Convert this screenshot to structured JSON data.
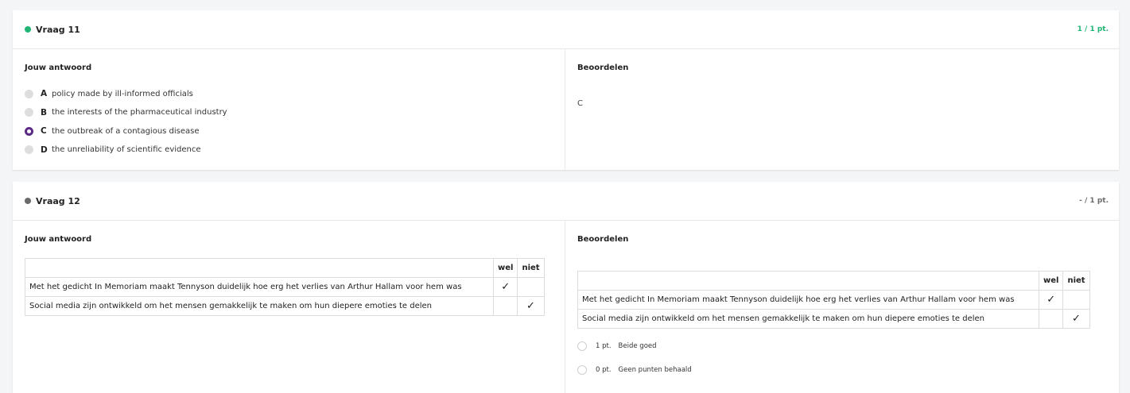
{
  "colors": {
    "correct": "#21b573",
    "pending": "#6b6b6b",
    "accent": "#5b2a86"
  },
  "q11": {
    "title": "Vraag 11",
    "score": "1 / 1 pt.",
    "your_answer_label": "Jouw antwoord",
    "grade_label": "Beoordelen",
    "options": [
      {
        "letter": "A",
        "text": "policy made by ill-informed officials",
        "selected": false
      },
      {
        "letter": "B",
        "text": "the interests of the pharmaceutical industry",
        "selected": false
      },
      {
        "letter": "C",
        "text": "the outbreak of a contagious disease",
        "selected": true
      },
      {
        "letter": "D",
        "text": "the unreliability of scientific evidence",
        "selected": false
      }
    ],
    "correct_answer": "C"
  },
  "q12": {
    "title": "Vraag 12",
    "score": "- / 1 pt.",
    "your_answer_label": "Jouw antwoord",
    "grade_label": "Beoordelen",
    "table": {
      "headers": [
        "wel",
        "niet"
      ],
      "rows": [
        {
          "statement": "Met het gedicht In Memoriam maakt Tennyson duidelijk hoe erg het verlies van Arthur Hallam voor hem was",
          "wel": "✓",
          "niet": ""
        },
        {
          "statement": "Social media zijn ontwikkeld om het mensen gemakkelijk te maken om hun diepere emoties te delen",
          "wel": "",
          "niet": "✓"
        }
      ]
    },
    "grade_table": {
      "headers": [
        "wel",
        "niet"
      ],
      "rows": [
        {
          "statement": "Met het gedicht In Memoriam maakt Tennyson duidelijk hoe erg het verlies van Arthur Hallam voor hem was",
          "wel": "✓",
          "niet": ""
        },
        {
          "statement": "Social media zijn ontwikkeld om het mensen gemakkelijk te maken om hun diepere emoties te delen",
          "wel": "",
          "niet": "✓"
        }
      ]
    },
    "score_options": [
      {
        "points": "1 pt.",
        "label": "Beide goed"
      },
      {
        "points": "0 pt.",
        "label": "Geen punten behaald"
      }
    ]
  }
}
